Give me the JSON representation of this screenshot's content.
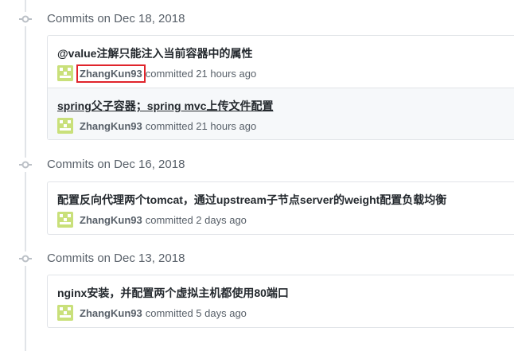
{
  "groups": [
    {
      "date": "Commits on Dec 18, 2018",
      "commits": [
        {
          "title": "@value注解只能注入当前容器中的属性",
          "author": "ZhangKun93",
          "time": "committed 21 hours ago"
        },
        {
          "title": "spring父子容器；spring mvc上传文件配置",
          "author": "ZhangKun93",
          "time": "committed 21 hours ago"
        }
      ]
    },
    {
      "date": "Commits on Dec 16, 2018",
      "commits": [
        {
          "title": "配置反向代理两个tomcat，通过upstream子节点server的weight配置负载均衡",
          "author": "ZhangKun93",
          "time": "committed 2 days ago"
        }
      ]
    },
    {
      "date": "Commits on Dec 13, 2018",
      "commits": [
        {
          "title": "nginx安装，并配置两个虚拟主机都使用80端口",
          "author": "ZhangKun93",
          "time": "committed 5 days ago"
        }
      ]
    }
  ],
  "colors": {
    "avatar": "#c9e07a",
    "highlight_box": "#e0242b",
    "timeline": "#e1e4e8"
  },
  "icons": {
    "group_marker": "git-commit-icon",
    "avatar": "identicon-avatar"
  }
}
